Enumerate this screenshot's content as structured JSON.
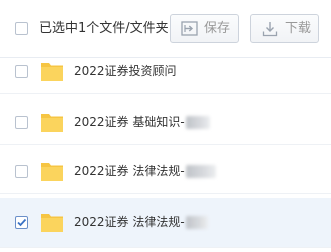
{
  "toolbar": {
    "selected_text": "已选中1个文件/文件夹",
    "save_label": "保存",
    "download_label": "下载"
  },
  "files": [
    {
      "name": "2022证券投资顾问",
      "checked": false
    },
    {
      "name": "2022证券 基础知识-",
      "checked": false
    },
    {
      "name": "2022证券 法律法规-",
      "checked": false
    },
    {
      "name": "2022证券 法律法规-",
      "checked": true
    }
  ],
  "colors": {
    "folder": "#f6c543",
    "check_accent": "#3a72c4",
    "selected_row": "#eef4fb"
  },
  "icons": {
    "save": "save-icon",
    "download": "download-icon",
    "folder": "folder-icon"
  }
}
